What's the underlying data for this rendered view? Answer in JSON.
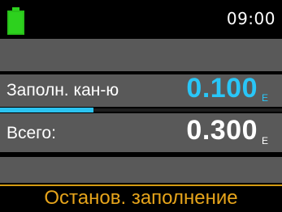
{
  "status": {
    "time": "09:00",
    "battery_color": "#2dd11e"
  },
  "fill": {
    "label": "Заполн. кан-ю",
    "value": "0.100",
    "unit": "Е",
    "progress_fraction": 0.33,
    "accent_color": "#29c6f7"
  },
  "total": {
    "label": "Всего:",
    "value": "0.300",
    "unit": "Е"
  },
  "soft_key": {
    "label": "Останов. заполнение",
    "color": "#e6a41b"
  }
}
